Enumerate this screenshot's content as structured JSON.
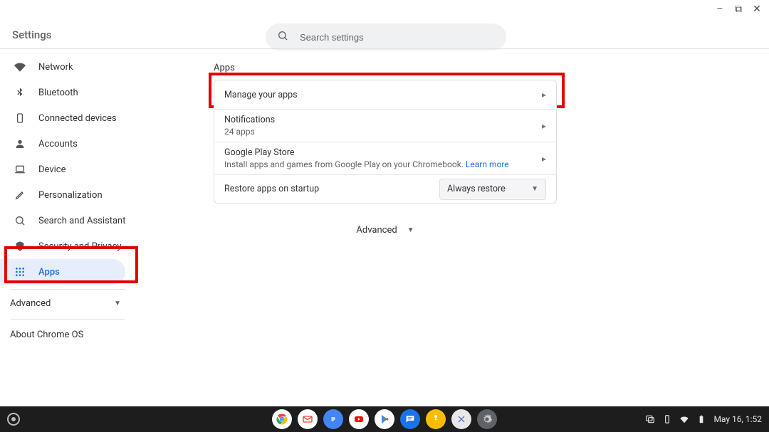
{
  "window": {
    "minimize": "–",
    "maximize": "⧉",
    "close": "✕"
  },
  "header": {
    "title": "Settings",
    "search_placeholder": "Search settings"
  },
  "sidebar": {
    "items": [
      {
        "label": "Network"
      },
      {
        "label": "Bluetooth"
      },
      {
        "label": "Connected devices"
      },
      {
        "label": "Accounts"
      },
      {
        "label": "Device"
      },
      {
        "label": "Personalization"
      },
      {
        "label": "Search and Assistant"
      },
      {
        "label": "Security and Privacy"
      },
      {
        "label": "Apps"
      }
    ],
    "advanced": "Advanced",
    "about": "About Chrome OS"
  },
  "main": {
    "section_title": "Apps",
    "rows": {
      "manage": {
        "title": "Manage your apps"
      },
      "notifications": {
        "title": "Notifications",
        "sub": "24 apps"
      },
      "play": {
        "title": "Google Play Store",
        "sub": "Install apps and games from Google Play on your Chromebook. ",
        "link": "Learn more"
      },
      "restore": {
        "title": "Restore apps on startup",
        "selected": "Always restore"
      }
    },
    "advanced_toggle": "Advanced"
  },
  "shelf": {
    "time": "May 16, 1:52"
  }
}
